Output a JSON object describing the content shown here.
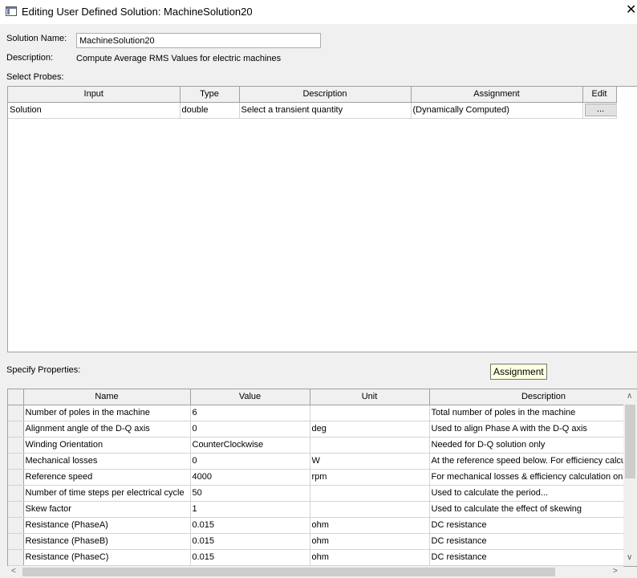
{
  "window": {
    "title": "Editing User Defined Solution: MachineSolution20",
    "close_glyph": "✕"
  },
  "form": {
    "solution_name_label": "Solution Name:",
    "solution_name_value": "MachineSolution20",
    "description_label": "Description:",
    "description_value": "Compute Average  RMS Values for electric machines",
    "select_probes_label": "Select Probes:",
    "specify_properties_label": "Specify Properties:"
  },
  "probes": {
    "headers": [
      "Input",
      "Type",
      "Description",
      "Assignment",
      "Edit"
    ],
    "rows": [
      {
        "input": "Solution",
        "type": "double",
        "description": "Select a transient quantity",
        "assignment": "(Dynamically Computed)",
        "edit_label": "..."
      }
    ]
  },
  "tooltip": {
    "text": "Assignment"
  },
  "properties": {
    "headers": [
      "Name",
      "Value",
      "Unit",
      "Description"
    ],
    "rows": [
      {
        "name": "Number of poles in the machine",
        "value": "6",
        "unit": "",
        "description": "Total number of poles in the machine"
      },
      {
        "name": "Alignment angle of the D-Q axis",
        "value": "0",
        "unit": "deg",
        "description": "Used to align Phase A with the D-Q axis"
      },
      {
        "name": "Winding Orientation",
        "value": "CounterClockwise",
        "unit": "",
        "description": "Needed for D-Q solution only"
      },
      {
        "name": "Mechanical losses",
        "value": "0",
        "unit": "W",
        "description": "At the reference speed below. For efficiency calcu"
      },
      {
        "name": "Reference speed",
        "value": "4000",
        "unit": "rpm",
        "description": "For mechanical losses & efficiency calculation only."
      },
      {
        "name": "Number of time steps per electrical cycle",
        "value": "50",
        "unit": "",
        "description": "Used to calculate the period..."
      },
      {
        "name": "Skew factor",
        "value": "1",
        "unit": "",
        "description": "Used to calculate the effect of skewing"
      },
      {
        "name": "Resistance (PhaseA)",
        "value": "0.015",
        "unit": "ohm",
        "description": "DC resistance"
      },
      {
        "name": "Resistance (PhaseB)",
        "value": "0.015",
        "unit": "ohm",
        "description": "DC resistance"
      },
      {
        "name": "Resistance (PhaseC)",
        "value": "0.015",
        "unit": "ohm",
        "description": "DC resistance"
      }
    ]
  },
  "scroll_icons": {
    "up": "∧",
    "down": "∨",
    "left": "<",
    "right": ">"
  }
}
